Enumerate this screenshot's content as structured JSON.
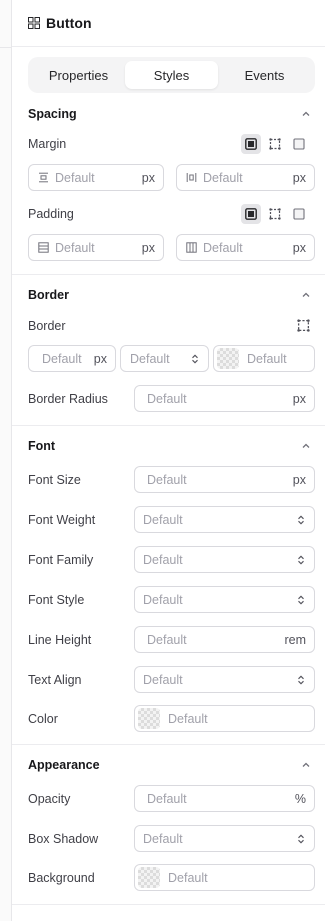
{
  "header": {
    "title": "Button",
    "icon": "component-icon"
  },
  "tabs": [
    "Properties",
    "Styles",
    "Events"
  ],
  "active_tab": "Styles",
  "spacing": {
    "title": "Spacing",
    "margin_label": "Margin",
    "padding_label": "Padding",
    "placeholder": "Default",
    "unit": "px"
  },
  "border": {
    "title": "Border",
    "border_label": "Border",
    "radius_label": "Border Radius",
    "width_placeholder": "Default",
    "width_unit": "px",
    "style_placeholder": "Default",
    "color_placeholder": "Default",
    "radius_placeholder": "Default",
    "radius_unit": "px"
  },
  "font": {
    "title": "Font",
    "size_label": "Font Size",
    "size_placeholder": "Default",
    "size_unit": "px",
    "weight_label": "Font Weight",
    "weight_value": "Default",
    "family_label": "Font Family",
    "family_value": "Default",
    "style_label": "Font Style",
    "style_value": "Default",
    "lineheight_label": "Line Height",
    "lineheight_placeholder": "Default",
    "lineheight_unit": "rem",
    "align_label": "Text Align",
    "align_value": "Default",
    "color_label": "Color",
    "color_placeholder": "Default"
  },
  "appearance": {
    "title": "Appearance",
    "opacity_label": "Opacity",
    "opacity_placeholder": "Default",
    "opacity_unit": "%",
    "shadow_label": "Box Shadow",
    "shadow_value": "Default",
    "background_label": "Background",
    "background_placeholder": "Default"
  }
}
